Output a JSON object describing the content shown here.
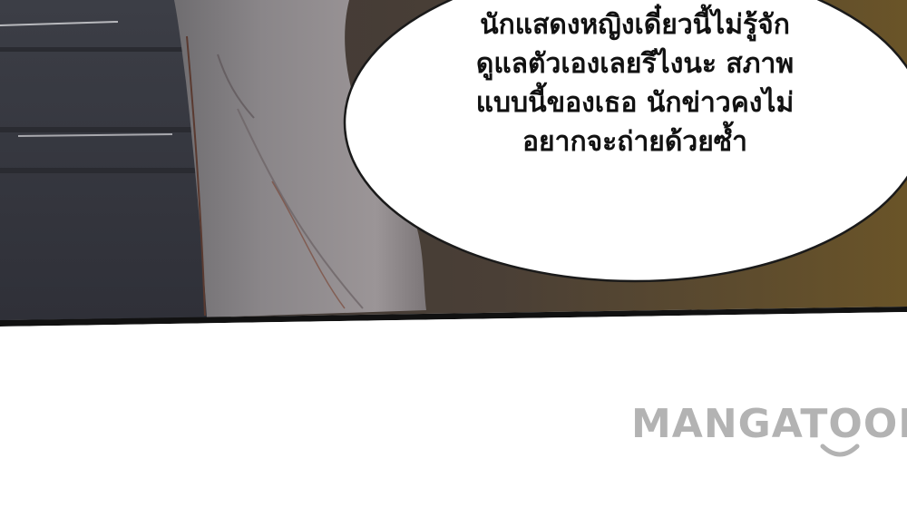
{
  "comic_panel": {
    "speech_bubble": {
      "lines": [
        "นักแสดงหญิงเดี๋ยวนี้ไม่รู้จัก",
        "ดูแลตัวเองเลยรึไงนะ สภาพ",
        "แบบนี้ของเธอ นักข่าวคงไม่",
        "อยากจะถ่ายด้วยซ้ำ"
      ]
    }
  },
  "watermark": {
    "text": "MANGATOON"
  }
}
